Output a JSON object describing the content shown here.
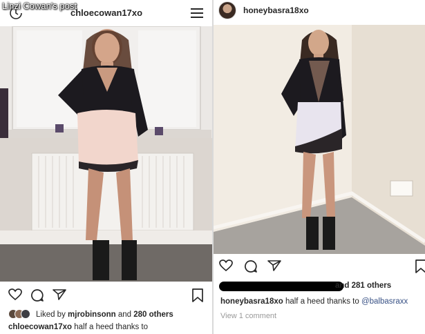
{
  "overlay_title": "Linzi Cowan's post",
  "left_post": {
    "username": "chloecowan17xo",
    "likes": {
      "prefix": "Liked by ",
      "user": "mjrobinsonn",
      "middle": " and ",
      "count": "280 others"
    },
    "caption": {
      "user": "chloecowan17xo",
      "text": " half a heed thanks to"
    }
  },
  "right_post": {
    "username": "honeybasra18xo",
    "likes": {
      "visible": "and 281 others"
    },
    "caption": {
      "user": "honeybasra18xo",
      "text": " half a heed thanks to ",
      "mention": "@balbasraxx"
    },
    "view_comments": "View 1 comment"
  },
  "icons": {
    "header_left": "history-icon",
    "header_right_left_panel": "menu-icon",
    "actions": [
      "heart-icon",
      "comment-icon",
      "share-icon",
      "bookmark-icon"
    ]
  },
  "colors": {
    "text": "#262626",
    "link": "#385185",
    "muted": "#999999"
  }
}
